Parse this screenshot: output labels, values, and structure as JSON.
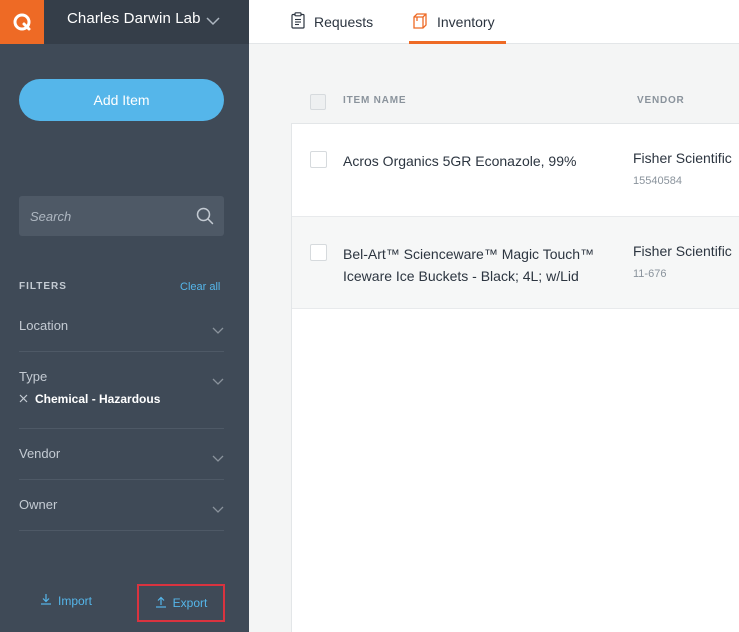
{
  "sidebar": {
    "logo_icon": "q-logo-icon",
    "lab_name": "Charles Darwin Lab",
    "add_item_label": "Add Item",
    "search_placeholder": "Search",
    "filters_label": "FILTERS",
    "clear_all_label": "Clear all",
    "filters": [
      {
        "label": "Location"
      },
      {
        "label": "Type",
        "selected": "Chemical - Hazardous"
      },
      {
        "label": "Vendor"
      },
      {
        "label": "Owner"
      }
    ],
    "import_label": "Import",
    "export_label": "Export"
  },
  "tabs": [
    {
      "label": "Requests",
      "icon": "clipboard-icon",
      "active": false
    },
    {
      "label": "Inventory",
      "icon": "box-icon",
      "active": true
    }
  ],
  "table": {
    "columns": [
      "ITEM NAME",
      "VENDOR"
    ],
    "rows": [
      {
        "name": "Acros Organics 5GR Econazole, 99%",
        "vendor": "Fisher Scientific",
        "catalog": "15540584"
      },
      {
        "name": "Bel-Art™ Scienceware™ Magic Touch™ Iceware Ice Buckets - Black; 4L; w/Lid",
        "vendor": "Fisher Scientific",
        "catalog": "11-676"
      }
    ]
  },
  "colors": {
    "accent": "#ee6a25",
    "primary": "#55b6ea",
    "sidebar": "#3f4a57",
    "highlight_border": "#d9333f"
  }
}
